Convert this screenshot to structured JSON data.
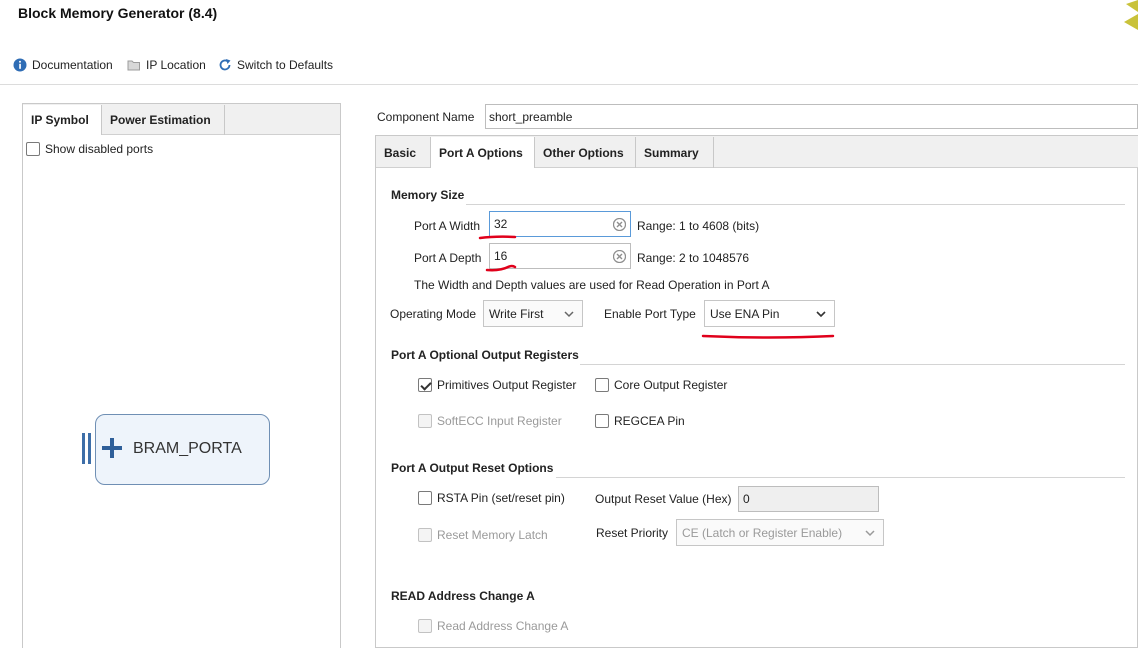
{
  "window": {
    "title": "Block Memory Generator (8.4)"
  },
  "toolbar": {
    "documentation": "Documentation",
    "ip_location": "IP Location",
    "switch_defaults": "Switch to Defaults"
  },
  "left": {
    "tabs": [
      "IP Symbol",
      "Power Estimation"
    ],
    "show_disabled_ports": "Show disabled ports",
    "bram_label": "BRAM_PORTA"
  },
  "component": {
    "label": "Component Name",
    "value": "short_preamble"
  },
  "tabs": [
    "Basic",
    "Port A Options",
    "Other Options",
    "Summary"
  ],
  "memory_size": {
    "title": "Memory Size",
    "width_label": "Port A Width",
    "width_value": "32",
    "width_range": "Range: 1 to 4608 (bits)",
    "depth_label": "Port A Depth",
    "depth_value": "16",
    "depth_range": "Range: 2 to 1048576",
    "note": "The Width and Depth values are used for Read Operation in Port A"
  },
  "mode": {
    "operating_label": "Operating Mode",
    "operating_value": "Write First",
    "enable_label": "Enable Port Type",
    "enable_value": "Use ENA Pin"
  },
  "optional_regs": {
    "title": "Port A Optional Output Registers",
    "primitives": "Primitives Output Register",
    "core": "Core Output Register",
    "softecc": "SoftECC Input Register",
    "regcea": "REGCEA Pin"
  },
  "reset": {
    "title": "Port A Output Reset Options",
    "rsta": "RSTA Pin (set/reset pin)",
    "output_reset_label": "Output Reset Value (Hex)",
    "output_reset_value": "0",
    "reset_latch": "Reset Memory Latch",
    "priority_label": "Reset Priority",
    "priority_value": "CE (Latch or Register Enable)"
  },
  "read_addr": {
    "title": "READ Address Change A",
    "option": "Read Address Change A"
  },
  "colors": {
    "accent": "#5a9ad9",
    "annotation": "#e0001b",
    "info_icon": "#2f6db5"
  }
}
